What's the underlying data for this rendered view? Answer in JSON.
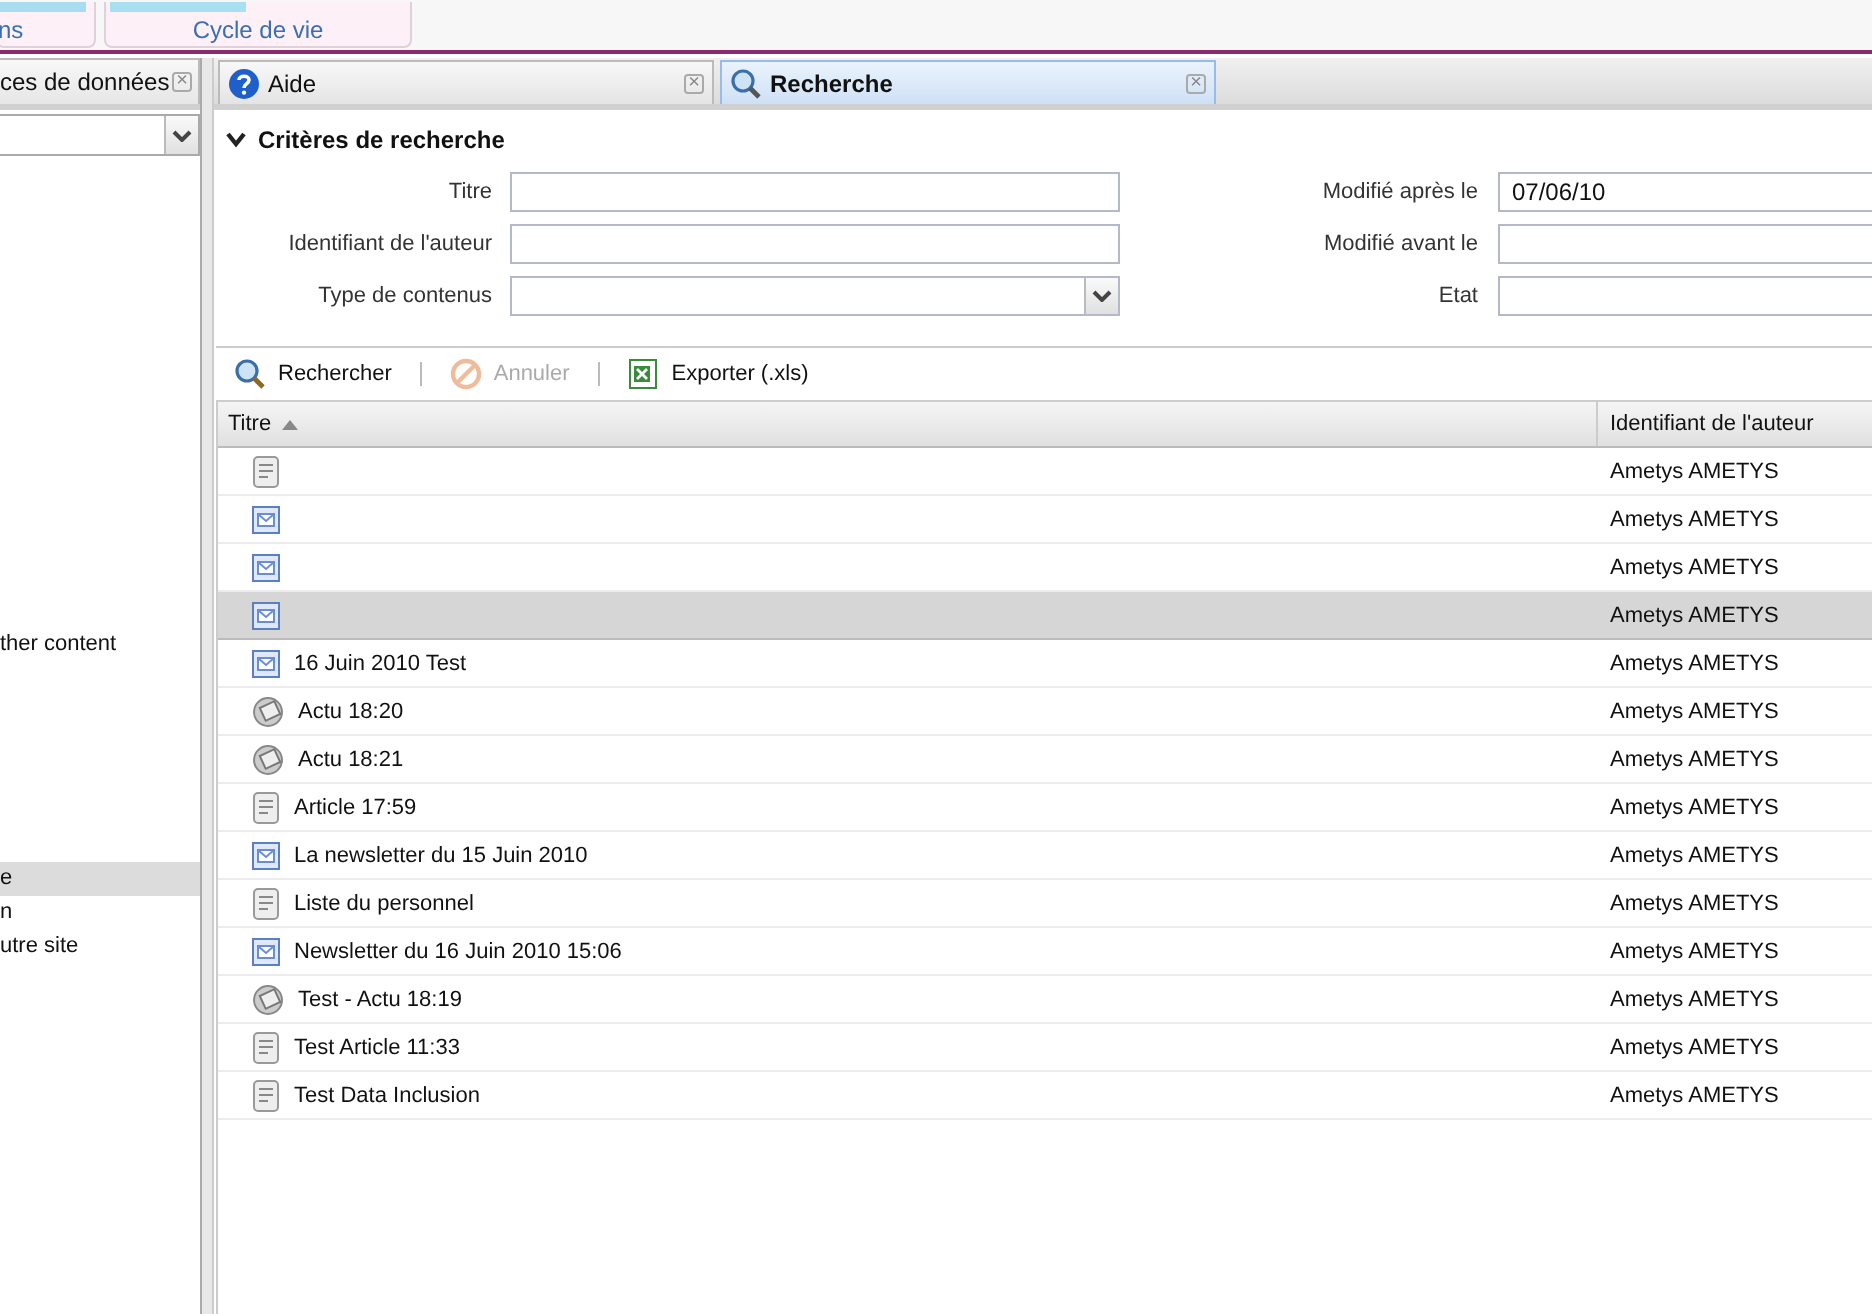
{
  "ribbon": {
    "groups": [
      {
        "label": "ns"
      },
      {
        "label": "Cycle de vie"
      }
    ]
  },
  "left_panel": {
    "tab": {
      "label": "ces de données",
      "close": "×"
    },
    "items": [
      {
        "label": "ther content",
        "selected": false
      },
      {
        "label": "e",
        "selected": true
      },
      {
        "label": "n",
        "selected": false
      },
      {
        "label": "utre site",
        "selected": false
      }
    ]
  },
  "tabs": [
    {
      "label": "Aide",
      "kind": "help",
      "selected": false,
      "close": "×"
    },
    {
      "label": "Recherche",
      "kind": "search",
      "selected": true,
      "close": "×"
    }
  ],
  "criteria": {
    "title": "Critères de recherche",
    "expanded": true,
    "left_fields": [
      {
        "label": "Titre",
        "kind": "text"
      },
      {
        "label": "Identifiant de l'auteur",
        "kind": "text"
      },
      {
        "label": "Type de contenus",
        "kind": "combo"
      }
    ],
    "right_fields": [
      {
        "label": "Modifié après le",
        "value": "07/06/10"
      },
      {
        "label": "Modifié avant le"
      },
      {
        "label": "Etat"
      }
    ]
  },
  "toolbar": [
    {
      "label": "Rechercher",
      "kind": "search",
      "disabled": false
    },
    {
      "label": "Annuler",
      "kind": "cancel",
      "disabled": true
    },
    {
      "label": "Exporter (.xls)",
      "kind": "excel",
      "disabled": false
    }
  ],
  "table": {
    "columns": [
      {
        "label": "Titre",
        "sorted_ascending": true
      },
      {
        "label": "Identifiant de l'auteur"
      }
    ],
    "rows": [
      {
        "kind": "doc",
        "author": "Ametys AMETYS",
        "selected": false
      },
      {
        "kind": "newsletter",
        "author": "Ametys AMETYS",
        "selected": false
      },
      {
        "kind": "newsletter",
        "author": "Ametys AMETYS",
        "selected": false
      },
      {
        "kind": "newsletter",
        "author": "Ametys AMETYS",
        "selected": true
      },
      {
        "kind": "newsletter",
        "title": "16 Juin 2010 Test",
        "author": "Ametys AMETYS",
        "selected": false
      },
      {
        "kind": "news",
        "title": "Actu 18:20",
        "author": "Ametys AMETYS",
        "selected": false
      },
      {
        "kind": "news",
        "title": "Actu 18:21",
        "author": "Ametys AMETYS",
        "selected": false
      },
      {
        "kind": "doc",
        "title": "Article 17:59",
        "author": "Ametys AMETYS",
        "selected": false
      },
      {
        "kind": "newsletter",
        "title": "La newsletter du 15 Juin 2010",
        "author": "Ametys AMETYS",
        "selected": false
      },
      {
        "kind": "doc",
        "title": "Liste du personnel",
        "author": "Ametys AMETYS",
        "selected": false
      },
      {
        "kind": "newsletter",
        "title": "Newsletter du 16 Juin 2010 15:06",
        "author": "Ametys AMETYS",
        "selected": false
      },
      {
        "kind": "news",
        "title": "Test - Actu 18:19",
        "author": "Ametys AMETYS",
        "selected": false
      },
      {
        "kind": "doc",
        "title": "Test Article 11:33",
        "author": "Ametys AMETYS",
        "selected": false
      },
      {
        "kind": "doc",
        "title": "Test Data Inclusion",
        "author": "Ametys AMETYS",
        "selected": false
      }
    ]
  }
}
